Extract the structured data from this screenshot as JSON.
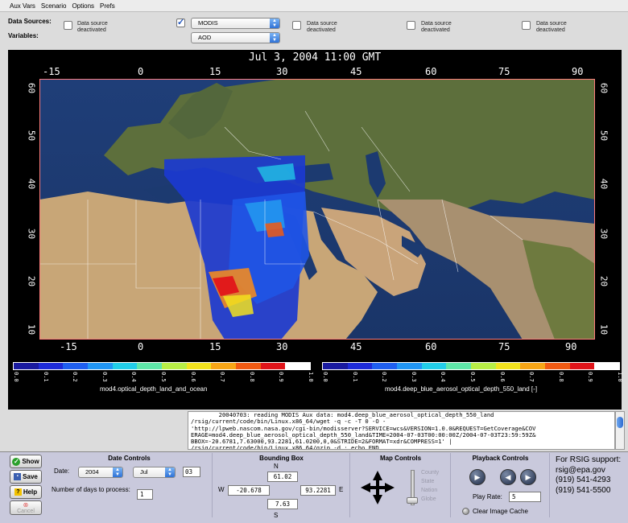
{
  "menu": [
    "Aux Vars",
    "Scenario",
    "Options",
    "Prefs"
  ],
  "data_sources_label": "Data Sources:",
  "variables_label": "Variables:",
  "data_sources": [
    {
      "checked": false,
      "text": "Data source\ndeactivated"
    },
    {
      "checked": true,
      "source": "MODIS",
      "variable": "AOD"
    },
    {
      "checked": false,
      "text": "Data source\ndeactivated"
    },
    {
      "checked": false,
      "text": "Data source\ndeactivated"
    },
    {
      "checked": false,
      "text": "Data source\ndeactivated"
    }
  ],
  "map": {
    "title": "Jul  3, 2004 11:00 GMT",
    "x_ticks": [
      "-15",
      "0",
      "15",
      "30",
      "45",
      "60",
      "75",
      "90"
    ],
    "y_ticks": [
      "60",
      "50",
      "40",
      "30",
      "20",
      "10"
    ]
  },
  "colorbars": {
    "left": {
      "title": "mod4.optical_depth_land_and_ocean",
      "ticks": [
        "0.0",
        "0.1",
        "0.2",
        "0.3",
        "0.4",
        "0.5",
        "0.6",
        "0.7",
        "0.8",
        "0.9",
        "1.0"
      ]
    },
    "right": {
      "title": "mod4.deep_blue_aerosol_optical_depth_550_land [-]",
      "ticks": [
        "0.0",
        "0.1",
        "0.2",
        "0.3",
        "0.4",
        "0.5",
        "0.6",
        "0.7",
        "0.8",
        "0.9",
        "1.0"
      ]
    },
    "colors": [
      "#1a1aa0",
      "#1e2bd8",
      "#1f5ff0",
      "#2196f5",
      "#22cde8",
      "#5fe6a8",
      "#b8ee46",
      "#f2e21e",
      "#f7a516",
      "#f15a12",
      "#e0141a",
      "#ffffff"
    ]
  },
  "log_text": "        20040703: reading MODIS Aux data: mod4.deep_blue_aerosol_optical_depth_550_land\n/rsig/current/code/bin/Linux.x86_64/wget -q -c -T 0 -O -\n'http://lpweb.nascom.nasa.gov/cgi-bin/modisserver?SERVICE=wcs&VERSION=1.0.0&REQUEST=GetCoverage&COV\nERAGE=mod4.deep_blue_aerosol_optical_depth_550_land&TIME=2004-07-03T00:00:00Z/2004-07-03T23:59:59Z&\nBBOX=-20.6781,7.63000,93.2281,61.0200,0,0&STRIDE=2&FORMAT=xdr&COMPRESS=1' |\n/rsig/current/code/bin/Linux.x86_64/gzip -d ; echo END",
  "side_buttons": {
    "show": "Show",
    "save": "Save",
    "help": "Help",
    "cancel": "Cancel"
  },
  "date_controls": {
    "title": "Date Controls",
    "date_label": "Date:",
    "year": "2004",
    "month": "Jul",
    "day": "03",
    "days_label": "Number of days to process:",
    "days_value": "1"
  },
  "bounding_box": {
    "title": "Bounding Box",
    "n_label": "N",
    "s_label": "S",
    "w_label": "W",
    "e_label": "E",
    "north": "61.02",
    "south": "7.63",
    "west": "-20.678",
    "east": "93.2281"
  },
  "map_controls": {
    "title": "Map Controls",
    "levels": [
      "County",
      "State",
      "Nation",
      "Globe"
    ]
  },
  "playback": {
    "title": "Playback Controls",
    "rate_label": "Play Rate:",
    "rate_value": "5",
    "clear_cache": "Clear Image Cache"
  },
  "support": {
    "heading": "For RSIG support:",
    "email": "rsig@epa.gov",
    "phone1": "(919) 541-4293",
    "phone2": "(919) 541-5500"
  }
}
